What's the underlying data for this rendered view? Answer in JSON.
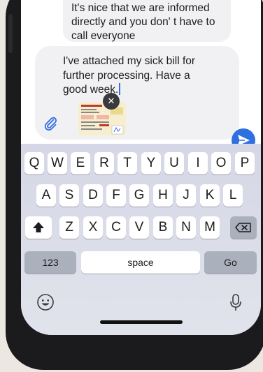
{
  "chat": {
    "previous_message": "Very good! That was really fast. It's nice that we are informed directly and you don' t have to call everyone",
    "draft_message": "I've attached my sick bill for further processing. Have a good week."
  },
  "icons": {
    "attach": "paperclip-icon",
    "send": "send-icon",
    "remove_attachment": "close-icon",
    "shift": "shift-icon",
    "backspace": "backspace-icon",
    "emoji": "emoji-icon",
    "dictation": "microphone-icon"
  },
  "keyboard": {
    "row1": [
      "Q",
      "W",
      "E",
      "R",
      "T",
      "Y",
      "U",
      "I",
      "O",
      "P"
    ],
    "row2": [
      "A",
      "S",
      "D",
      "F",
      "G",
      "H",
      "J",
      "K",
      "L"
    ],
    "row3": [
      "Z",
      "X",
      "C",
      "V",
      "B",
      "N",
      "M"
    ],
    "numbers_key": "123",
    "space_key": "space",
    "go_key": "Go"
  },
  "colors": {
    "accent": "#2f6fe0",
    "bubble": "#f1f1f3",
    "keyboard_bg": "#d8dae7",
    "function_key": "#abb0bd"
  }
}
